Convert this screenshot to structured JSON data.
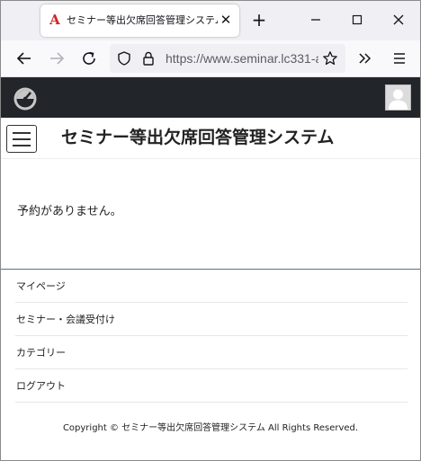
{
  "browser": {
    "tab_title": "セミナー等出欠席回答管理システム",
    "favicon_glyph": "A",
    "close_glyph": "✕",
    "new_tab_glyph": "+",
    "url": "https://www.seminar.lc331-a",
    "icons": [
      "back-arrow-icon",
      "forward-arrow-icon",
      "reload-icon",
      "shield-icon",
      "lock-icon",
      "bookmark-star-icon",
      "extensions-chevron-icon",
      "hamburger-menu-icon",
      "minimize-icon",
      "maximize-icon",
      "close-icon"
    ]
  },
  "header": {
    "title": "セミナー等出欠席回答管理システム",
    "icons": [
      "dashboard-icon",
      "user-avatar-icon",
      "menu-toggle-icon"
    ]
  },
  "main": {
    "empty_message": "予約がありません。"
  },
  "footer": {
    "menu": [
      {
        "label": "マイページ"
      },
      {
        "label": "セミナー・会議受付け"
      },
      {
        "label": "カテゴリー"
      },
      {
        "label": "ログアウト"
      }
    ],
    "copyright": "Copyright © セミナー等出欠席回答管理システム All Rights Reserved."
  },
  "colors": {
    "topbar": "#222529",
    "footer_border": "#57737f",
    "favicon": "#d2232a"
  }
}
